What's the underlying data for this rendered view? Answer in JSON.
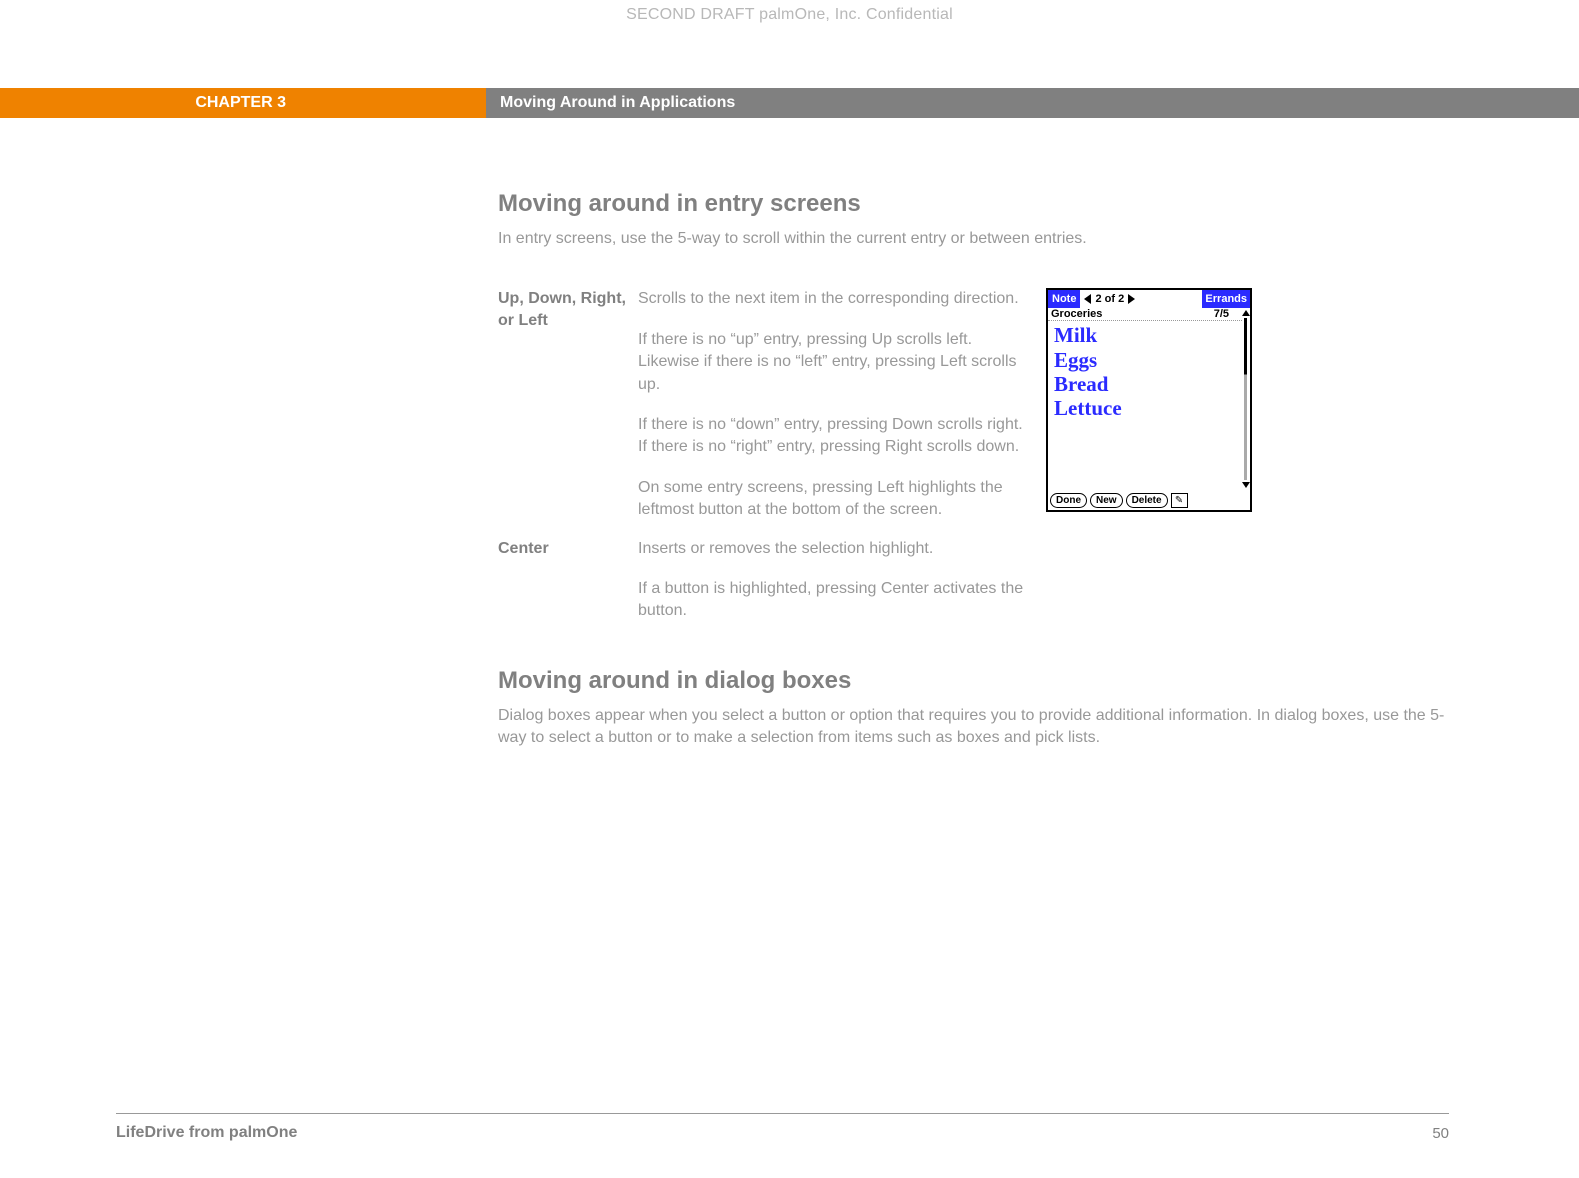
{
  "confidential": "SECOND DRAFT palmOne, Inc.  Confidential",
  "chapter": "CHAPTER 3",
  "chapter_title": "Moving Around in Applications",
  "section1": {
    "heading": "Moving around in entry screens",
    "intro": "In entry screens, use the 5-way to scroll within the current entry or between entries.",
    "rows": [
      {
        "label": "Up, Down, Right, or Left",
        "paras": [
          "Scrolls to the next item in the corresponding direction.",
          "If there is no “up” entry, pressing Up scrolls left. Likewise if there is no “left” entry, pressing Left scrolls up.",
          "If there is no “down” entry, pressing Down scrolls right. If there is no “right” entry, pressing Right scrolls down.",
          "On some entry screens, pressing Left highlights the leftmost button at the bottom of the screen."
        ]
      },
      {
        "label": "Center",
        "paras": [
          "Inserts or removes the selection highlight.",
          "If a button is highlighted, pressing Center activates the button."
        ]
      }
    ]
  },
  "section2": {
    "heading": "Moving around in dialog boxes",
    "intro": "Dialog boxes appear when you select a button or option that requires you to provide additional information. In dialog boxes, use the 5-way to select a button or to make a selection from items such as boxes and pick lists."
  },
  "screenshot": {
    "title": "Note",
    "counter": "2 of 2",
    "category": "Errands",
    "note_title": "Groceries",
    "date": "7/5",
    "items": [
      "Milk",
      "Eggs",
      "Bread",
      "Lettuce"
    ],
    "buttons": {
      "done": "Done",
      "new": "New",
      "delete": "Delete"
    }
  },
  "footer": {
    "product": "LifeDrive from palmOne",
    "page": "50"
  }
}
